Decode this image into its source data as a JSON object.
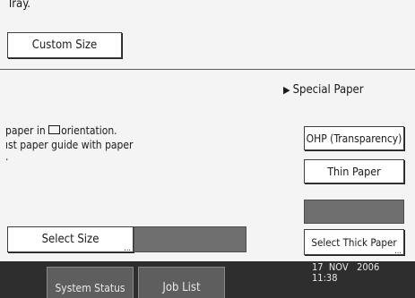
{
  "top": {
    "tray_text": "Tray.",
    "custom_size_label": "Custom Size"
  },
  "middle": {
    "special_paper_label": "Special Paper",
    "special_paper_icon": "triangle-right-icon",
    "instruction_line1_pre": "paper in ",
    "orientation_icon": "paper-orientation-icon",
    "instruction_line1_post": "orientation.",
    "instruction_line2": "ıst paper guide with paper",
    "instruction_line3": "."
  },
  "paper_buttons": {
    "ohp": "OHP (Transparency)",
    "thin": "Thin Paper",
    "select_thick": "Select Thick Paper"
  },
  "bottom": {
    "select_size_label": "Select Size",
    "ellipsis": "..."
  },
  "status_bar": {
    "system_status": "System Status",
    "job_list": "Job List",
    "date": "17  NOV   2006",
    "time": "11:38"
  }
}
